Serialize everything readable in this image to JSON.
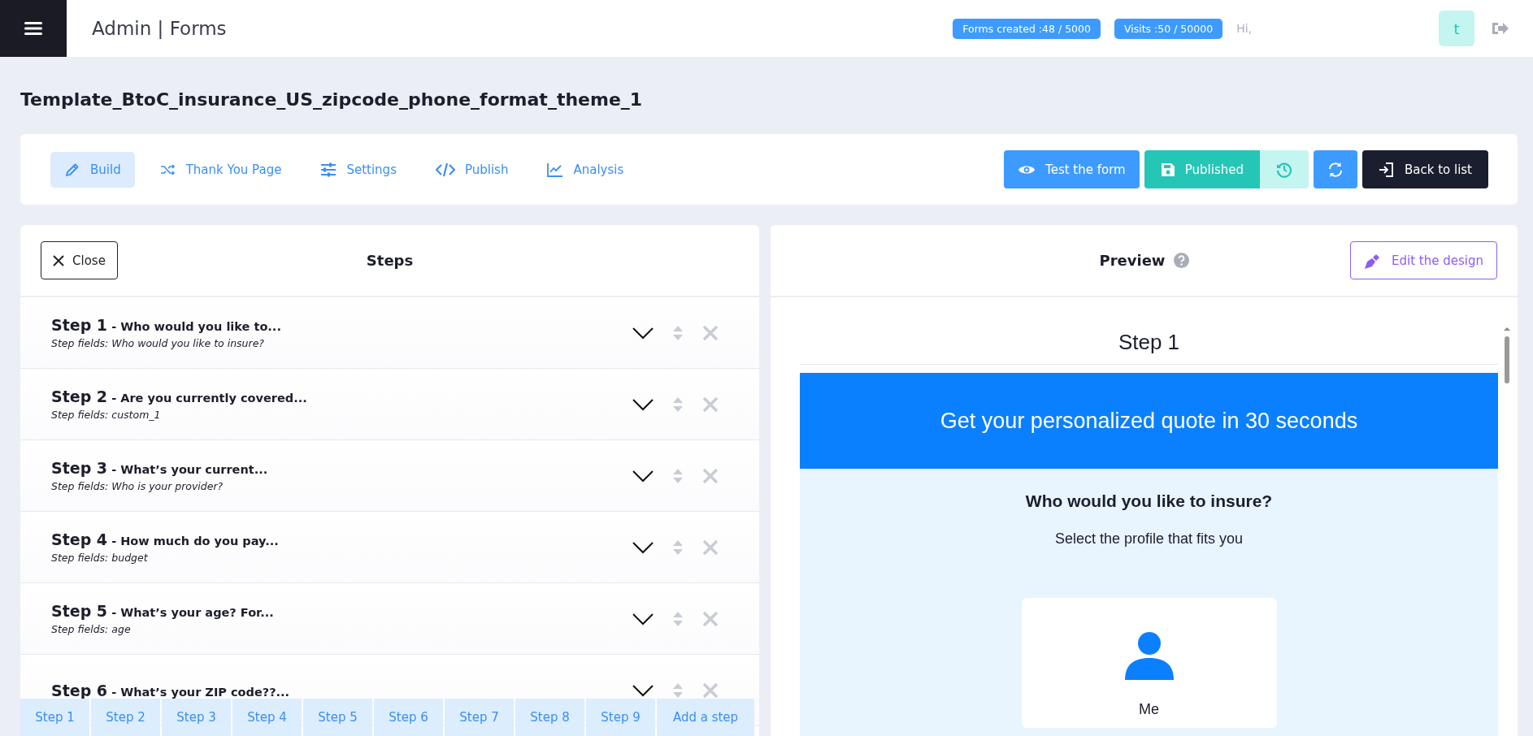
{
  "header": {
    "title": "Admin | Forms",
    "badges": [
      "Forms created :48 / 5000",
      "Visits :50 / 50000"
    ],
    "greeting": "Hi,",
    "avatar": "t"
  },
  "page_title": "Template_BtoC_insurance_US_zipcode_phone_format_theme_1",
  "tabs": [
    {
      "label": "Build",
      "kind": "pencil",
      "selected": true
    },
    {
      "label": "Thank You Page",
      "kind": "shuffle",
      "selected": false
    },
    {
      "label": "Settings",
      "kind": "sliders",
      "selected": false
    },
    {
      "label": "Publish",
      "kind": "code",
      "selected": false
    },
    {
      "label": "Analysis",
      "kind": "chart",
      "selected": false
    }
  ],
  "actions": {
    "test": "Test the form",
    "published": "Published",
    "back": "Back to list"
  },
  "steps_panel": {
    "close": "Close",
    "title": "Steps",
    "steps": [
      {
        "number": "Step 1",
        "title": " - Who would you like to...",
        "fields": "Step fields: Who would you like to insure?"
      },
      {
        "number": "Step 2",
        "title": " - Are you currently covered...",
        "fields": "Step fields: custom_1"
      },
      {
        "number": "Step 3",
        "title": " - What’s your current...",
        "fields": "Step fields: Who is your provider?"
      },
      {
        "number": "Step 4",
        "title": " - How much do you pay...",
        "fields": "Step fields: budget"
      },
      {
        "number": "Step 5",
        "title": " - What’s your age? For...",
        "fields": "Step fields: age"
      },
      {
        "number": "Step 6",
        "title": " - What’s your ZIP code??..."
      }
    ]
  },
  "step_nav": {
    "steps": [
      "Step 1",
      "Step 2",
      "Step 3",
      "Step 4",
      "Step 5",
      "Step 6",
      "Step 7",
      "Step 8",
      "Step 9"
    ],
    "add": "Add a step"
  },
  "preview": {
    "title": "Preview",
    "edit": "Edit the design",
    "step": "Step 1",
    "banner": "Get your personalized quote in 30 seconds",
    "question": "Who would you like to insure?",
    "subtitle": "Select the profile that fits you",
    "options": [
      {
        "label": "Me"
      }
    ]
  }
}
